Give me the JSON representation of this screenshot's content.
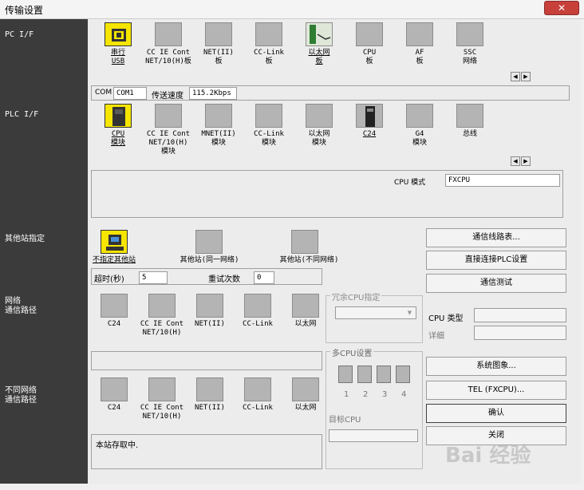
{
  "window": {
    "title": "传输设置",
    "close": "✕"
  },
  "sections": {
    "pc_if": "PC I/F",
    "plc_if": "PLC I/F",
    "other_station": "其他站指定",
    "network_route_1": "网络",
    "network_route_2": "通信路径",
    "diff_network_1": "不同网络",
    "diff_network_2": "通信路径"
  },
  "pc_tiles": [
    {
      "l1": "串行",
      "l2": "USB"
    },
    {
      "l1": "CC IE Cont",
      "l2": "NET/10(H)板"
    },
    {
      "l1": "NET(II)",
      "l2": "板"
    },
    {
      "l1": "CC-Link",
      "l2": "板"
    },
    {
      "l1": "以太网",
      "l2": "板"
    },
    {
      "l1": "CPU",
      "l2": "板"
    },
    {
      "l1": "AF",
      "l2": "板"
    },
    {
      "l1": "SSC",
      "l2": "网络"
    }
  ],
  "com_row": {
    "com_label": "COM",
    "com_value": "COM1",
    "speed_label": "传送速度",
    "speed_value": "115.2Kbps"
  },
  "plc_tiles": [
    {
      "l1": "CPU",
      "l2": "模块",
      "l3": ""
    },
    {
      "l1": "CC IE Cont",
      "l2": "NET/10(H)",
      "l3": "模块"
    },
    {
      "l1": "MNET(II)",
      "l2": "模块",
      "l3": ""
    },
    {
      "l1": "CC-Link",
      "l2": "模块",
      "l3": ""
    },
    {
      "l1": "以太网",
      "l2": "模块",
      "l3": ""
    },
    {
      "l1": "C24",
      "l2": "",
      "l3": ""
    },
    {
      "l1": "G4",
      "l2": "模块",
      "l3": ""
    },
    {
      "l1": "总线",
      "l2": "",
      "l3": ""
    }
  ],
  "cpu_mode": {
    "label": "CPU 模式",
    "value": "FXCPU"
  },
  "other_tiles": [
    {
      "label": "不指定其他站"
    },
    {
      "label": "其他站(同一网络)"
    },
    {
      "label": "其他站(不同网络)"
    }
  ],
  "timeout": {
    "label": "超时(秒)",
    "value": "5",
    "retry_label": "重试次数",
    "retry_value": "0"
  },
  "route_tiles": [
    "C24",
    "CC IE Cont",
    "NET(II)",
    "CC-Link",
    "以太网"
  ],
  "route_tile2_l2": "NET/10(H)",
  "redundant": {
    "label": "冗余CPU指定"
  },
  "multi_cpu": {
    "label": "多CPU设置",
    "nums": [
      "1",
      "2",
      "3",
      "4"
    ],
    "target_label": "目标CPU"
  },
  "status_text": "本站存取中.",
  "buttons": {
    "route_list": "通信线路表...",
    "direct_plc": "直接连接PLC设置",
    "comm_test": "通信测试",
    "system_image": "系统图象...",
    "tel": "TEL (FXCPU)...",
    "confirm": "确认",
    "close": "关闭"
  },
  "cpu_type": {
    "label": "CPU 类型",
    "detail_label": "详细"
  },
  "watermark": "Bai 经验",
  "colors": {
    "left_panel": "#3b3b3b",
    "selected_tile": "#f5e500",
    "close_button": "#c7403a"
  }
}
